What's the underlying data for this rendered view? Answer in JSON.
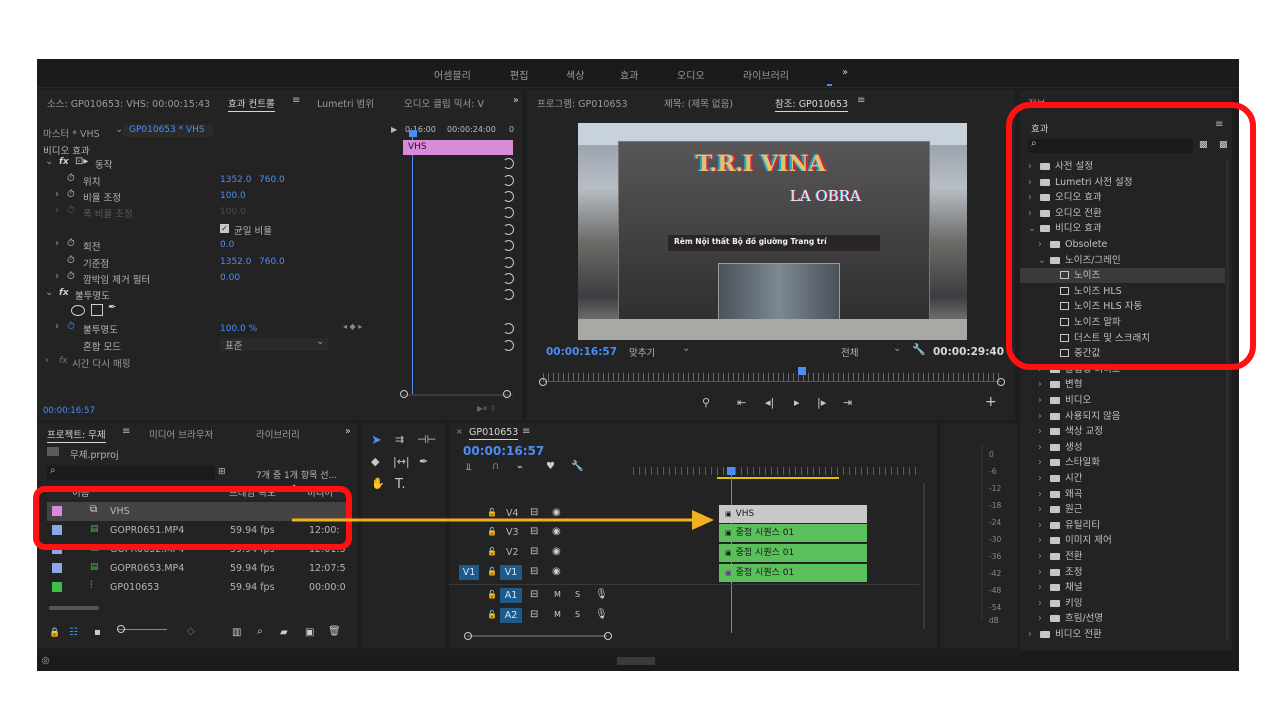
{
  "workspaces": [
    "어셈블리",
    "편집",
    "색상",
    "효과",
    "오디오",
    "라이브러리",
    "»"
  ],
  "source_panel": {
    "tabs": [
      "소스: GP010653: VHS: 00:00:15:43",
      "효과 컨트롤",
      "Lumetri 범위",
      "오디오 클립 믹서: V",
      "»"
    ],
    "master_label": "마스터 * VHS",
    "clip_select": "GP010653 * VHS",
    "ruler_start": "0:16:00",
    "ruler_end": "00:00:24:00",
    "clip_label": "VHS",
    "section_video": "비디오 효과",
    "motion": "동작",
    "position_label": "위치",
    "position_x": "1352.0",
    "position_y": "760.0",
    "scale_label": "비율 조정",
    "scale_value": "100.0",
    "scale_width_label": "폭 비율 조정",
    "scale_width_value": "100.0",
    "uniform_scale": "균일 비율",
    "rotation_label": "회전",
    "rotation_value": "0.0",
    "anchor_label": "기준점",
    "anchor_x": "1352.0",
    "anchor_y": "760.0",
    "flicker_label": "깜박임 제거 필터",
    "flicker_value": "0.00",
    "opacity_section": "불투명도",
    "opacity_label": "불투명도",
    "opacity_value": "100.0 %",
    "blend_label": "혼합 모드",
    "blend_value": "표준",
    "time_remap": "시간 다시 매핑",
    "timecode": "00:00:16:57"
  },
  "program_panel": {
    "tabs": [
      "프로그램: GP010653",
      "제목: (제목 없음)",
      "참조: GP010653"
    ],
    "storefront_sign": "T.R.I VINA",
    "storefront_sign2": "LA OBRA",
    "storefront_banner": "Rèm Nội thất Bộ đồ giường Trang trí",
    "timecode": "00:00:16:57",
    "fit": "맞추기",
    "quality": "전체",
    "duration": "00:00:29:40"
  },
  "project_panel": {
    "tabs": [
      "프로젝트: 무제",
      "미디어 브라우저",
      "라이브러리",
      "»"
    ],
    "project_file": "무제.prproj",
    "count_text": "7개 중 1개 항목 선...",
    "columns": [
      "이름",
      "프레임 속도",
      "미디어"
    ],
    "rows": [
      {
        "name": "VHS",
        "fps": "",
        "media": "",
        "color": "#d98ad9"
      },
      {
        "name": "GOPR0651.MP4",
        "fps": "59.94 fps",
        "media": "12:00:",
        "color": "#8aa8e6"
      },
      {
        "name": "GOPR0652.MP4",
        "fps": "59.94 fps",
        "media": "12:01:5",
        "color": "#8aa8e6"
      },
      {
        "name": "GOPR0653.MP4",
        "fps": "59.94 fps",
        "media": "12:07:5",
        "color": "#8aa8e6"
      },
      {
        "name": "GP010653",
        "fps": "59.94 fps",
        "media": "00:00:0",
        "color": "#3fbf4a"
      }
    ]
  },
  "timeline": {
    "sequence_tab": "GP010653",
    "timecode": "00:00:16:57",
    "tracks": [
      {
        "name": "V4",
        "src": ""
      },
      {
        "name": "V3",
        "src": ""
      },
      {
        "name": "V2",
        "src": ""
      },
      {
        "name": "V1",
        "src": "V1"
      },
      {
        "name": "A1",
        "src": ""
      },
      {
        "name": "A2",
        "src": ""
      }
    ],
    "clips": [
      "VHS",
      "중첩 시퀀스 01",
      "중첩 시퀀스 01",
      "중첩 시퀀스 01"
    ],
    "audio_m": "M",
    "audio_s": "S"
  },
  "meter_labels": [
    "0",
    "-6",
    "-12",
    "-18",
    "-24",
    "-30",
    "-36",
    "-42",
    "-48",
    "-54",
    "dB"
  ],
  "effects_panel": {
    "info_tab": "정보",
    "title": "효과",
    "items": [
      {
        "label": "사전 설정",
        "type": "folder",
        "level": 0,
        "open": false
      },
      {
        "label": "Lumetri 사전 설정",
        "type": "folder",
        "level": 0,
        "open": false
      },
      {
        "label": "오디오 효과",
        "type": "folder",
        "level": 0,
        "open": false
      },
      {
        "label": "오디오 전환",
        "type": "folder",
        "level": 0,
        "open": false
      },
      {
        "label": "비디오 효과",
        "type": "folder",
        "level": 0,
        "open": true
      },
      {
        "label": "Obsolete",
        "type": "folder",
        "level": 1,
        "open": false
      },
      {
        "label": "노이즈/그레인",
        "type": "folder",
        "level": 1,
        "open": true
      },
      {
        "label": "노이즈",
        "type": "effect",
        "level": 2,
        "selected": true
      },
      {
        "label": "노이즈 HLS",
        "type": "effect",
        "level": 2
      },
      {
        "label": "노이즈 HLS 자동",
        "type": "effect",
        "level": 2
      },
      {
        "label": "노이즈 알파",
        "type": "effect",
        "level": 2
      },
      {
        "label": "더스트 및 스크래치",
        "type": "effect",
        "level": 2
      },
      {
        "label": "중간값",
        "type": "effect",
        "level": 2
      },
      {
        "label": "몰입형 비디오",
        "type": "folder",
        "level": 1,
        "open": false
      },
      {
        "label": "변형",
        "type": "folder",
        "level": 1,
        "open": false
      },
      {
        "label": "비디오",
        "type": "folder",
        "level": 1,
        "open": false
      },
      {
        "label": "사용되지 않음",
        "type": "folder",
        "level": 1,
        "open": false
      },
      {
        "label": "색상 교정",
        "type": "folder",
        "level": 1,
        "open": false
      },
      {
        "label": "생성",
        "type": "folder",
        "level": 1,
        "open": false
      },
      {
        "label": "스타일화",
        "type": "folder",
        "level": 1,
        "open": false
      },
      {
        "label": "시간",
        "type": "folder",
        "level": 1,
        "open": false
      },
      {
        "label": "왜곡",
        "type": "folder",
        "level": 1,
        "open": false
      },
      {
        "label": "원근",
        "type": "folder",
        "level": 1,
        "open": false
      },
      {
        "label": "유틸리티",
        "type": "folder",
        "level": 1,
        "open": false
      },
      {
        "label": "이미지 제어",
        "type": "folder",
        "level": 1,
        "open": false
      },
      {
        "label": "전환",
        "type": "folder",
        "level": 1,
        "open": false
      },
      {
        "label": "조정",
        "type": "folder",
        "level": 1,
        "open": false
      },
      {
        "label": "채널",
        "type": "folder",
        "level": 1,
        "open": false
      },
      {
        "label": "키잉",
        "type": "folder",
        "level": 1,
        "open": false
      },
      {
        "label": "흐림/선명",
        "type": "folder",
        "level": 1,
        "open": false
      },
      {
        "label": "비디오 전환",
        "type": "folder",
        "level": 0,
        "open": false
      }
    ]
  },
  "colors": {
    "accent_blue": "#4d8df3",
    "clip_pink": "#d98ad9",
    "clip_green": "#5bbf5b",
    "highlight_red": "#ff1111",
    "arrow_yellow": "#f2b01e"
  }
}
